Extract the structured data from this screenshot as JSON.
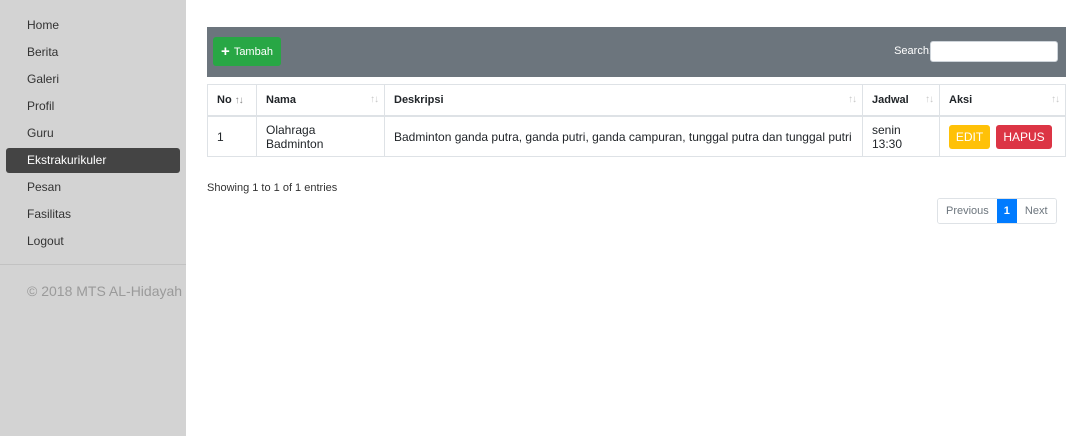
{
  "sidebar": {
    "items": [
      {
        "label": "Home"
      },
      {
        "label": "Berita"
      },
      {
        "label": "Galeri"
      },
      {
        "label": "Profil"
      },
      {
        "label": "Guru"
      },
      {
        "label": "Ekstrakurikuler",
        "active": true
      },
      {
        "label": "Pesan"
      },
      {
        "label": "Fasilitas"
      },
      {
        "label": "Logout"
      }
    ],
    "footer": "© 2018 MTS AL-Hidayah"
  },
  "toolbar": {
    "add_label": "Tambah",
    "search_label": "Search:",
    "search_value": ""
  },
  "table": {
    "columns": [
      "No",
      "Nama",
      "Deskripsi",
      "Jadwal",
      "Aksi"
    ],
    "rows": [
      {
        "no": "1",
        "nama": "Olahraga Badminton",
        "deskripsi": "Badminton ganda putra, ganda putri, ganda campuran, tunggal putra  dan tunggal putri",
        "jadwal": "senin 13:30",
        "edit_label": "EDIT",
        "delete_label": "HAPUS"
      }
    ]
  },
  "info": "Showing 1 to 1 of 1 entries",
  "pagination": {
    "previous": "Previous",
    "current": "1",
    "next": "Next"
  },
  "colors": {
    "sidebar_bg": "#d3d3d3",
    "active_item": "#444444",
    "toolbar_bg": "#6c757d",
    "add_button": "#28a745",
    "edit_button": "#ffc107",
    "delete_button": "#dc3545",
    "page_active": "#007bff"
  },
  "icons": {
    "add": "plus-icon",
    "sort": "sort-icon"
  }
}
